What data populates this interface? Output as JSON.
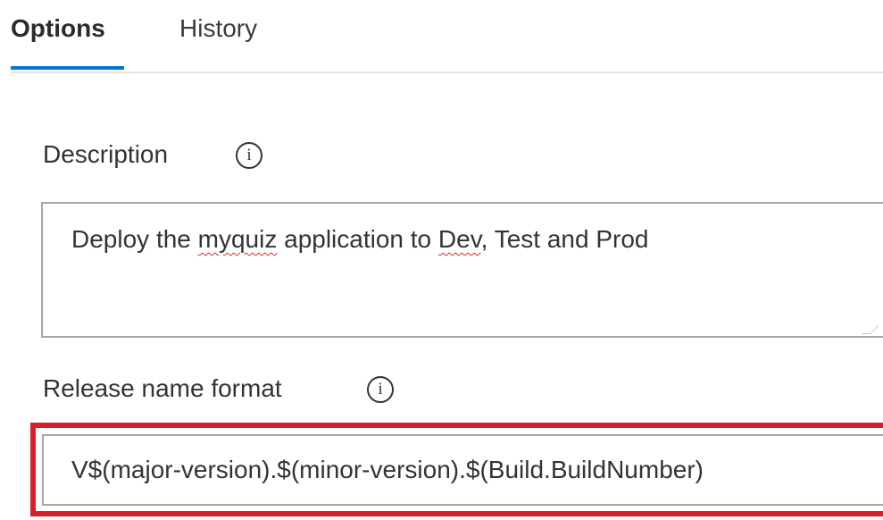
{
  "tabs": [
    {
      "label": "Options",
      "active": true
    },
    {
      "label": "History",
      "active": false
    }
  ],
  "accent_color": "#0078d4",
  "highlight_color": "#d71f2a",
  "description": {
    "label": "Description",
    "icon": "info-icon",
    "value_parts": [
      "Deploy the ",
      "myquiz",
      " application to ",
      "Dev",
      ", Test and Prod"
    ],
    "spelling_flagged": [
      "myquiz",
      "Dev"
    ]
  },
  "release_name_format": {
    "label": "Release name format",
    "icon": "info-icon",
    "value": "V$(major-version).$(minor-version).$(Build.BuildNumber)"
  }
}
